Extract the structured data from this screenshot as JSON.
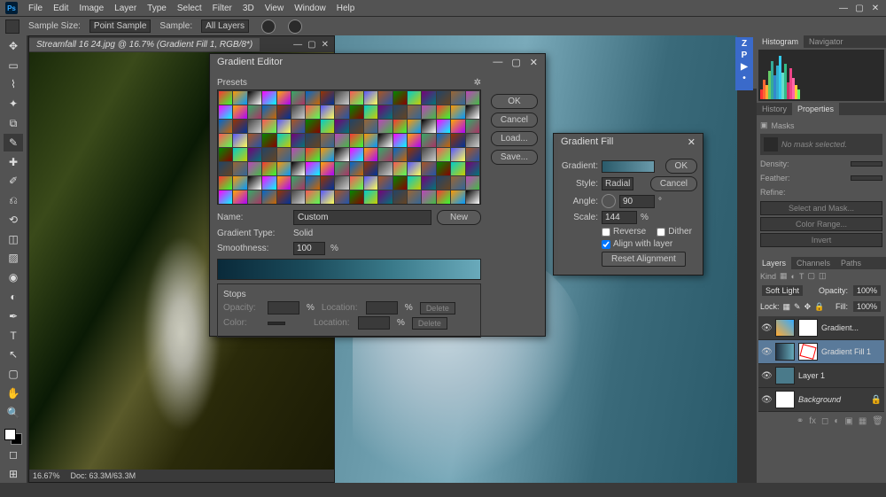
{
  "menu": {
    "items": [
      "File",
      "Edit",
      "Image",
      "Layer",
      "Type",
      "Select",
      "Filter",
      "3D",
      "View",
      "Window",
      "Help"
    ]
  },
  "options": {
    "sample_size_label": "Sample Size:",
    "sample_size_value": "Point Sample",
    "sample_label": "Sample:",
    "sample_value": "All Layers"
  },
  "doc_tab": "Streamfall 16 24.jpg @ 16.7% (Gradient Fill 1, RGB/8*)",
  "doc_zoom": "16.67%",
  "doc_info": "Doc: 63.3M/63.3M",
  "panels": {
    "histogram": "Histogram",
    "navigator": "Navigator",
    "history": "History",
    "properties": "Properties",
    "masks_label": "Masks",
    "no_mask": "No mask selected.",
    "density": "Density:",
    "feather": "Feather:",
    "refine": "Refine:",
    "select_and_mask": "Select and Mask...",
    "color_range": "Color Range...",
    "invert": "Invert"
  },
  "layers": {
    "tab_layers": "Layers",
    "tab_channels": "Channels",
    "tab_paths": "Paths",
    "kind": "Kind",
    "blend": "Soft Light",
    "opacity_label": "Opacity:",
    "opacity": "100%",
    "lock": "Lock:",
    "fill_label": "Fill:",
    "fill": "100%",
    "items": [
      {
        "name": "Gradient...",
        "sel": false
      },
      {
        "name": "Gradient Fill 1",
        "sel": true
      },
      {
        "name": "Layer 1",
        "sel": false
      },
      {
        "name": "Background",
        "sel": false,
        "locked": true
      }
    ]
  },
  "gradfill": {
    "title": "Gradient Fill",
    "gradient": "Gradient:",
    "style": "Style:",
    "style_value": "Radial",
    "angle": "Angle:",
    "angle_value": "90",
    "scale": "Scale:",
    "scale_value": "144",
    "scale_unit": "%",
    "reverse": "Reverse",
    "dither": "Dither",
    "align": "Align with layer",
    "reset": "Reset Alignment",
    "ok": "OK",
    "cancel": "Cancel"
  },
  "gradedit": {
    "title": "Gradient Editor",
    "presets": "Presets",
    "name": "Name:",
    "name_value": "Custom",
    "new": "New",
    "gtype": "Gradient Type:",
    "gtype_value": "Solid",
    "smooth": "Smoothness:",
    "smooth_value": "100",
    "smooth_unit": "%",
    "stops": "Stops",
    "opacity": "Opacity:",
    "location": "Location:",
    "delete": "Delete",
    "color": "Color:",
    "pct": "%",
    "ok": "OK",
    "cancel": "Cancel",
    "load": "Load...",
    "save": "Save..."
  }
}
